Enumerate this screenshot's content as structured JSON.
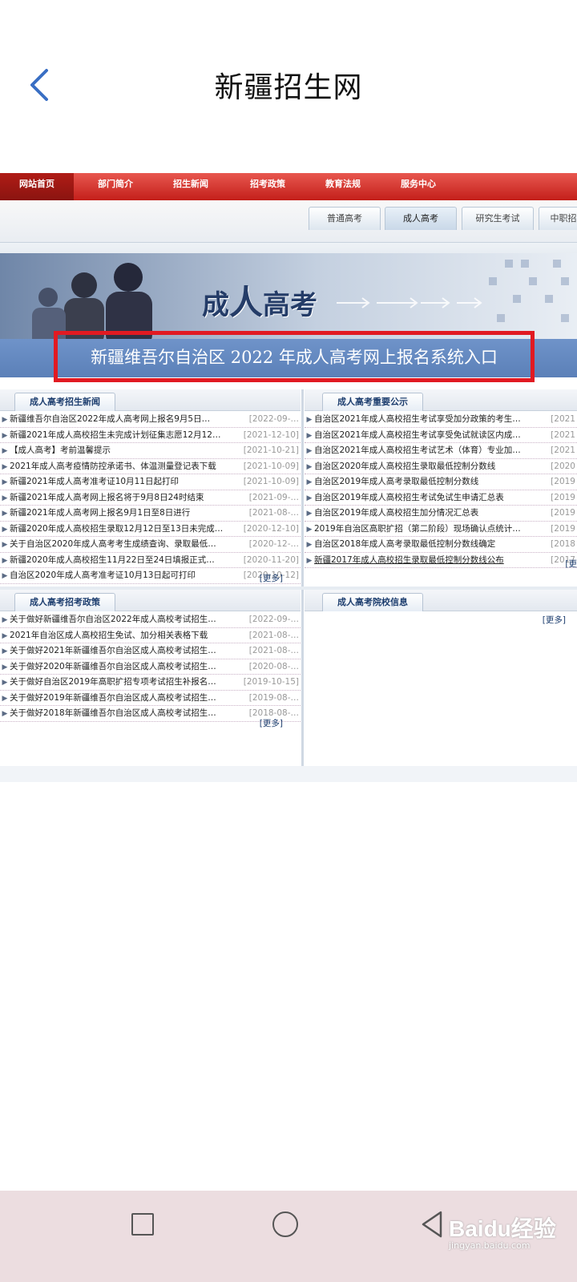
{
  "app": {
    "title": "新疆招生网"
  },
  "nav": [
    "网站首页",
    "部门简介",
    "招生新闻",
    "招考政策",
    "教育法规",
    "服务中心"
  ],
  "tabs": [
    "普通高考",
    "成人高考",
    "研究生考试",
    "中职招"
  ],
  "banner": {
    "title_small_1": "成",
    "title_big": "人",
    "title_small_2": "高考"
  },
  "entry": {
    "text": "新疆维吾尔自治区 2022 年成人高考网上报名系统入口"
  },
  "news": {
    "heading": "成人高考招生新闻",
    "items": [
      {
        "title": "新疆维吾尔自治区2022年成人高考网上报名9月5日…",
        "date": "[2022-09-…"
      },
      {
        "title": "新疆2021年成人高校招生未完成计划征集志愿12月12…",
        "date": "[2021-12-10]"
      },
      {
        "title": "【成人高考】考前温馨提示",
        "date": "[2021-10-21]"
      },
      {
        "title": "2021年成人高考疫情防控承诺书、体温测量登记表下载",
        "date": "[2021-10-09]"
      },
      {
        "title": "新疆2021年成人高考准考证10月11日起打印",
        "date": "[2021-10-09]"
      },
      {
        "title": "新疆2021年成人高考网上报名将于9月8日24时结束",
        "date": "[2021-09-…"
      },
      {
        "title": "新疆2021年成人高考网上报名9月1日至8日进行",
        "date": "[2021-08-…"
      },
      {
        "title": "新疆2020年成人高校招生录取12月12日至13日未完成…",
        "date": "[2020-12-10]"
      },
      {
        "title": "关于自治区2020年成人高考考生成绩查询、录取最低…",
        "date": "[2020-12-…"
      },
      {
        "title": "新疆2020年成人高校招生11月22日至24日填报正式…",
        "date": "[2020-11-20]"
      },
      {
        "title": "自治区2020年成人高考准考证10月13日起可打印",
        "date": "[2020-10-12]"
      }
    ],
    "more": "[更多]"
  },
  "notices": {
    "heading": "成人高考重要公示",
    "items": [
      {
        "title": "自治区2021年成人高校招生考试享受加分政策的考生…",
        "date": "[2021"
      },
      {
        "title": "自治区2021年成人高校招生考试享受免试就读区内成…",
        "date": "[2021"
      },
      {
        "title": "自治区2021年成人高校招生考试艺术（体育）专业加…",
        "date": "[2021"
      },
      {
        "title": "自治区2020年成人高校招生录取最低控制分数线",
        "date": "[2020"
      },
      {
        "title": "自治区2019年成人高考录取最低控制分数线",
        "date": "[2019"
      },
      {
        "title": "自治区2019年成人高校招生考试免试生申请汇总表",
        "date": "[2019"
      },
      {
        "title": "自治区2019年成人高校招生加分情况汇总表",
        "date": "[2019"
      },
      {
        "title": "2019年自治区高职扩招（第二阶段）现场确认点统计…",
        "date": "[2019"
      },
      {
        "title": "自治区2018年成人高考录取最低控制分数线确定",
        "date": "[2018"
      },
      {
        "title": "新疆2017年成人高校招生录取最低控制分数线公布",
        "date": "[2017"
      }
    ],
    "more": "[更"
  },
  "policy": {
    "heading": "成人高考招考政策",
    "items": [
      {
        "title": "关于做好新疆维吾尔自治区2022年成人高校考试招生…",
        "date": "[2022-09-…"
      },
      {
        "title": "2021年自治区成人高校招生免试、加分相关表格下载",
        "date": "[2021-08-…"
      },
      {
        "title": "关于做好2021年新疆维吾尔自治区成人高校考试招生…",
        "date": "[2021-08-…"
      },
      {
        "title": "关于做好2020年新疆维吾尔自治区成人高校考试招生…",
        "date": "[2020-08-…"
      },
      {
        "title": "关于做好自治区2019年高职扩招专项考试招生补报名…",
        "date": "[2019-10-15]"
      },
      {
        "title": "关于做好2019年新疆维吾尔自治区成人高校考试招生…",
        "date": "[2019-08-…"
      },
      {
        "title": "关于做好2018年新疆维吾尔自治区成人高校考试招生…",
        "date": "[2018-08-…"
      }
    ],
    "more": "[更多]"
  },
  "schools": {
    "heading": "成人高考院校信息",
    "more": "[更多]"
  },
  "watermark": {
    "brand": "Baidu经验",
    "site": "jingyan.baidu.com"
  }
}
